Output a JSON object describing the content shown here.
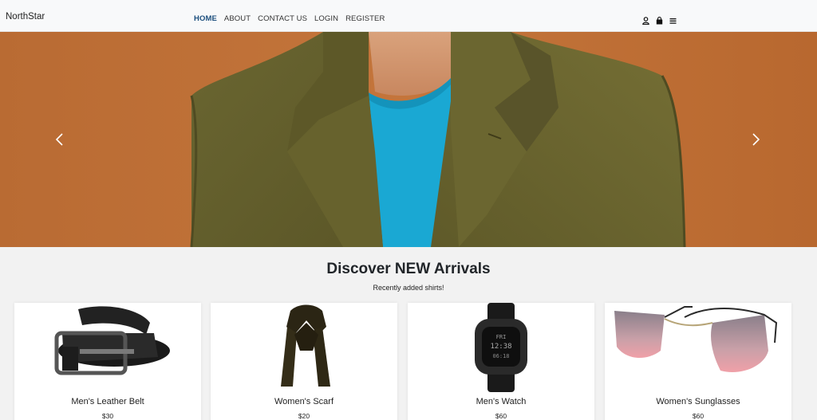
{
  "navbar": {
    "brand": "NorthStar",
    "links": [
      {
        "label": "HOME",
        "active": true
      },
      {
        "label": "ABOUT"
      },
      {
        "label": "CONTACT US"
      },
      {
        "label": "LOGIN"
      },
      {
        "label": "REGISTER"
      }
    ],
    "icons": [
      "user-icon",
      "shopping-bag-icon",
      "menu-icon"
    ],
    "active_color": "#1d4f7e"
  },
  "hero": {
    "background_color": "#b86a35",
    "jacket_color": "#6f6a2f",
    "shirt_color": "#1aa8d3",
    "controls": [
      "carousel-prev-icon",
      "carousel-next-icon"
    ]
  },
  "section": {
    "title": "Discover NEW Arrivals",
    "subtitle": "Recently added shirts!"
  },
  "products": [
    {
      "name": "Men's Leather Belt",
      "price": "$30",
      "icon": "belt-image"
    },
    {
      "name": "Women's Scarf",
      "price": "$20",
      "icon": "scarf-image"
    },
    {
      "name": "Men's Watch",
      "price": "$60",
      "icon": "watch-image"
    },
    {
      "name": "Women's Sunglasses",
      "price": "$60",
      "icon": "sunglasses-image"
    }
  ]
}
